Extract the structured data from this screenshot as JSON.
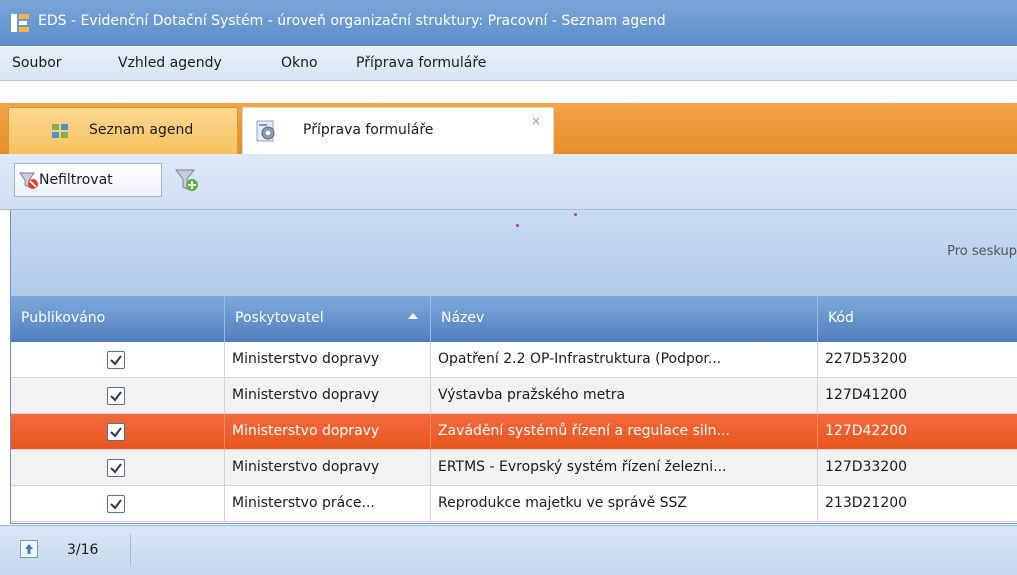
{
  "window": {
    "title": "EDS - Evidenční Dotační Systém - úroveň organizační struktury: Pracovní - Seznam agend"
  },
  "menu": [
    {
      "label": "Soubor"
    },
    {
      "label": "Vzhled agendy"
    },
    {
      "label": "Okno"
    },
    {
      "label": "Příprava formuláře"
    }
  ],
  "tabs": [
    {
      "label": "Seznam agend",
      "icon": "grid-icon",
      "active": false
    },
    {
      "label": "Příprava formuláře",
      "icon": "gear-icon",
      "active": true,
      "close": "×"
    }
  ],
  "toolbar": {
    "nofilter_label": "Nefiltrovat",
    "nofilter_icon": "filter-off-icon",
    "addfilter_icon": "filter-add-icon"
  },
  "group_panel": {
    "hint": "Pro seskup"
  },
  "grid": {
    "columns": [
      {
        "label": "Publikováno"
      },
      {
        "label": "Poskytovatel",
        "sorted": "ascending"
      },
      {
        "label": "Název"
      },
      {
        "label": "Kód"
      }
    ],
    "rows": [
      {
        "published": true,
        "provider": "Ministerstvo dopravy",
        "name": "Opatření 2.2 OP-Infrastruktura (Podpor...",
        "code": "227D53200",
        "selected": false
      },
      {
        "published": true,
        "provider": "Ministerstvo dopravy",
        "name": "Výstavba pražského metra",
        "code": "127D41200",
        "selected": false
      },
      {
        "published": true,
        "provider": "Ministerstvo dopravy",
        "name": "Zavádění systémů řízení a regulace siln...",
        "code": "127D42200",
        "selected": true
      },
      {
        "published": true,
        "provider": "Ministerstvo dopravy",
        "name": "ERTMS - Evropský systém řízení železni...",
        "code": "127D33200",
        "selected": false
      },
      {
        "published": true,
        "provider": "Ministerstvo práce...",
        "name": "Reprodukce majetku ve správě SSZ",
        "code": "213D21200",
        "selected": false
      }
    ]
  },
  "status": {
    "record_position": "3/16"
  },
  "colors": {
    "titlebar": "#5e8fcb",
    "tabstrip": "#e88c2a",
    "selected_row": "#e8551f",
    "header": "#4f7fbf"
  }
}
